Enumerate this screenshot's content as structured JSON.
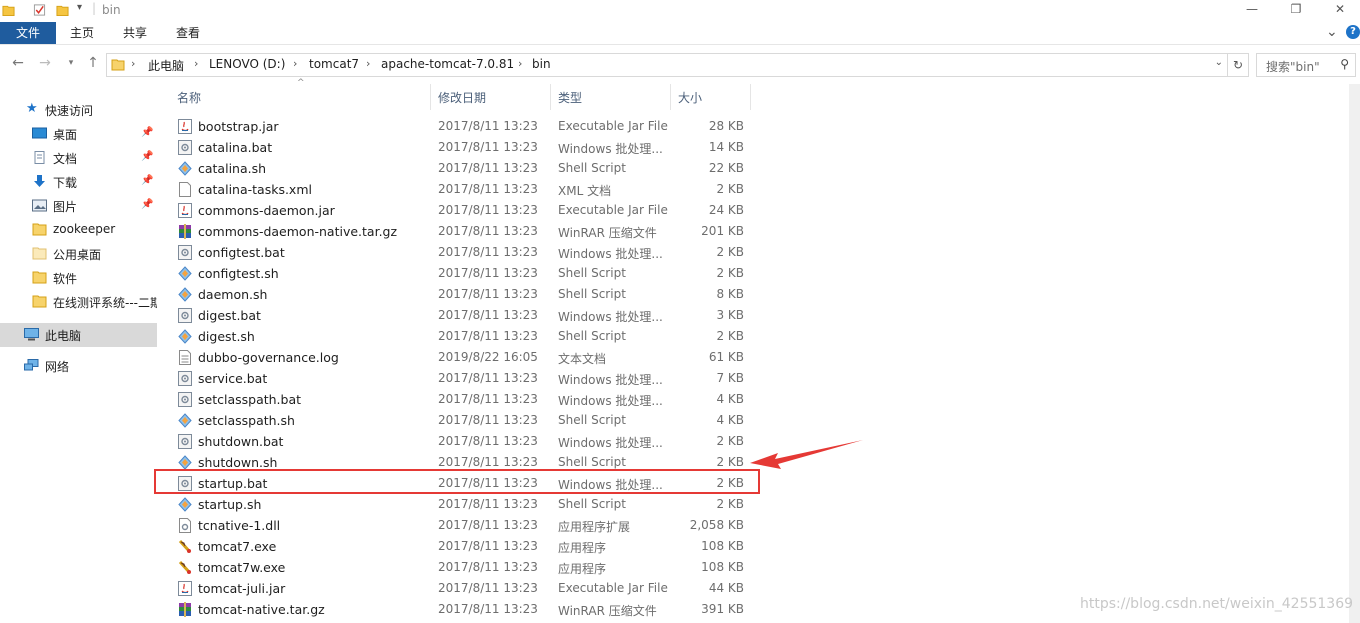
{
  "window": {
    "title": "bin",
    "minimize": "—",
    "restore": "❐",
    "close": "✕"
  },
  "ribbon": {
    "tabs": [
      "文件",
      "主页",
      "共享",
      "查看"
    ],
    "expand": "⌄",
    "help": "?"
  },
  "address": {
    "crumbs": [
      "此电脑",
      "LENOVO (D:)",
      "tomcat7",
      "apache-tomcat-7.0.81",
      "bin"
    ],
    "search_placeholder": "搜索\"bin\""
  },
  "nav": {
    "quick_access": "快速访问",
    "items": [
      {
        "label": "桌面",
        "icon": "desktop-icon",
        "pinned": true
      },
      {
        "label": "文档",
        "icon": "document-icon",
        "pinned": true
      },
      {
        "label": "下载",
        "icon": "download-icon",
        "pinned": true
      },
      {
        "label": "图片",
        "icon": "picture-icon",
        "pinned": true
      },
      {
        "label": "zookeeper",
        "icon": "folder-icon",
        "pinned": false
      },
      {
        "label": "公用桌面",
        "icon": "folder-icon",
        "pinned": false
      },
      {
        "label": "软件",
        "icon": "folder-icon",
        "pinned": false
      },
      {
        "label": "在线测评系统---二期",
        "icon": "folder-icon",
        "pinned": false
      }
    ],
    "this_pc": "此电脑",
    "network": "网络"
  },
  "columns": {
    "name": "名称",
    "date": "修改日期",
    "type": "类型",
    "size": "大小"
  },
  "files": [
    {
      "name": "bootstrap.jar",
      "date": "2017/8/11 13:23",
      "type": "Executable Jar File",
      "size": "28 KB",
      "icon": "jar-icon"
    },
    {
      "name": "catalina.bat",
      "date": "2017/8/11 13:23",
      "type": "Windows 批处理...",
      "size": "14 KB",
      "icon": "bat-icon"
    },
    {
      "name": "catalina.sh",
      "date": "2017/8/11 13:23",
      "type": "Shell Script",
      "size": "22 KB",
      "icon": "sh-icon"
    },
    {
      "name": "catalina-tasks.xml",
      "date": "2017/8/11 13:23",
      "type": "XML 文档",
      "size": "2 KB",
      "icon": "xml-icon"
    },
    {
      "name": "commons-daemon.jar",
      "date": "2017/8/11 13:23",
      "type": "Executable Jar File",
      "size": "24 KB",
      "icon": "jar-icon"
    },
    {
      "name": "commons-daemon-native.tar.gz",
      "date": "2017/8/11 13:23",
      "type": "WinRAR 压缩文件",
      "size": "201 KB",
      "icon": "winrar-icon"
    },
    {
      "name": "configtest.bat",
      "date": "2017/8/11 13:23",
      "type": "Windows 批处理...",
      "size": "2 KB",
      "icon": "bat-icon"
    },
    {
      "name": "configtest.sh",
      "date": "2017/8/11 13:23",
      "type": "Shell Script",
      "size": "2 KB",
      "icon": "sh-icon"
    },
    {
      "name": "daemon.sh",
      "date": "2017/8/11 13:23",
      "type": "Shell Script",
      "size": "8 KB",
      "icon": "sh-icon"
    },
    {
      "name": "digest.bat",
      "date": "2017/8/11 13:23",
      "type": "Windows 批处理...",
      "size": "3 KB",
      "icon": "bat-icon"
    },
    {
      "name": "digest.sh",
      "date": "2017/8/11 13:23",
      "type": "Shell Script",
      "size": "2 KB",
      "icon": "sh-icon"
    },
    {
      "name": "dubbo-governance.log",
      "date": "2019/8/22 16:05",
      "type": "文本文档",
      "size": "61 KB",
      "icon": "text-icon"
    },
    {
      "name": "service.bat",
      "date": "2017/8/11 13:23",
      "type": "Windows 批处理...",
      "size": "7 KB",
      "icon": "bat-icon"
    },
    {
      "name": "setclasspath.bat",
      "date": "2017/8/11 13:23",
      "type": "Windows 批处理...",
      "size": "4 KB",
      "icon": "bat-icon"
    },
    {
      "name": "setclasspath.sh",
      "date": "2017/8/11 13:23",
      "type": "Shell Script",
      "size": "4 KB",
      "icon": "sh-icon"
    },
    {
      "name": "shutdown.bat",
      "date": "2017/8/11 13:23",
      "type": "Windows 批处理...",
      "size": "2 KB",
      "icon": "bat-icon"
    },
    {
      "name": "shutdown.sh",
      "date": "2017/8/11 13:23",
      "type": "Shell Script",
      "size": "2 KB",
      "icon": "sh-icon"
    },
    {
      "name": "startup.bat",
      "date": "2017/8/11 13:23",
      "type": "Windows 批处理...",
      "size": "2 KB",
      "icon": "bat-icon",
      "highlighted": true
    },
    {
      "name": "startup.sh",
      "date": "2017/8/11 13:23",
      "type": "Shell Script",
      "size": "2 KB",
      "icon": "sh-icon"
    },
    {
      "name": "tcnative-1.dll",
      "date": "2017/8/11 13:23",
      "type": "应用程序扩展",
      "size": "2,058 KB",
      "icon": "dll-icon"
    },
    {
      "name": "tomcat7.exe",
      "date": "2017/8/11 13:23",
      "type": "应用程序",
      "size": "108 KB",
      "icon": "tomcat-exe-icon"
    },
    {
      "name": "tomcat7w.exe",
      "date": "2017/8/11 13:23",
      "type": "应用程序",
      "size": "108 KB",
      "icon": "tomcat-exe-icon"
    },
    {
      "name": "tomcat-juli.jar",
      "date": "2017/8/11 13:23",
      "type": "Executable Jar File",
      "size": "44 KB",
      "icon": "jar-icon"
    },
    {
      "name": "tomcat-native.tar.gz",
      "date": "2017/8/11 13:23",
      "type": "WinRAR 压缩文件",
      "size": "391 KB",
      "icon": "winrar-icon"
    }
  ],
  "annotation_color": "#e53935",
  "watermark": "https://blog.csdn.net/weixin_42551369"
}
